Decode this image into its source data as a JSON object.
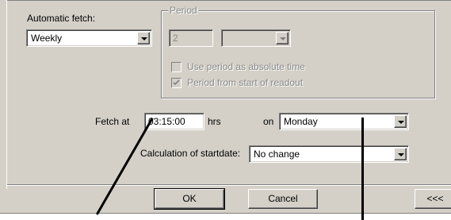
{
  "fetch": {
    "automatic_label": "Automatic fetch:",
    "frequency_value": "Weekly"
  },
  "period": {
    "group_label": "Period",
    "number_value": "2",
    "unit_value": "",
    "use_absolute_label": "Use period as absolute time",
    "use_absolute_checked": false,
    "from_start_label": "Period from start of readout",
    "from_start_checked": true
  },
  "schedule": {
    "fetch_at_label": "Fetch at",
    "time_value": "03:15:00",
    "hrs_label": "hrs",
    "on_label": "on",
    "day_value": "Monday",
    "calc_label": "Calculation of startdate:",
    "calc_value": "No change"
  },
  "buttons": {
    "ok": "OK",
    "cancel": "Cancel",
    "collapse": "<<<"
  }
}
